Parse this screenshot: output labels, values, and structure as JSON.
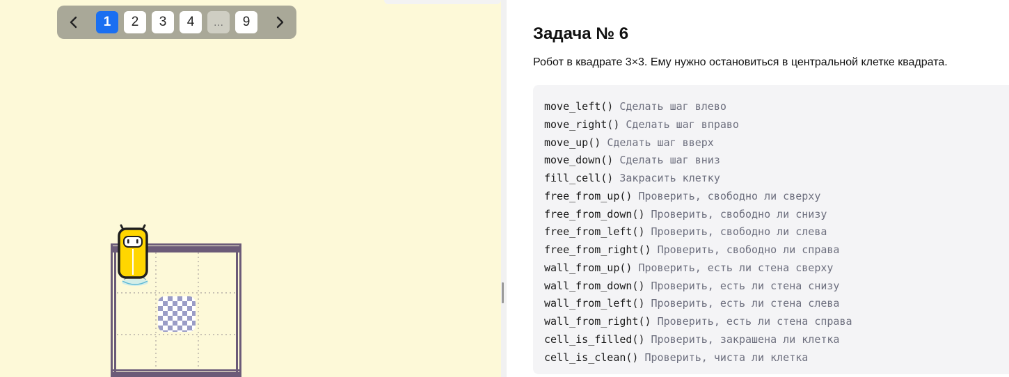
{
  "pager": {
    "pages": [
      "1",
      "2",
      "3",
      "4",
      "…",
      "9"
    ],
    "active_page": "1"
  },
  "task": {
    "title": "Задача № 6",
    "description": "Робот в квадрате 3×3. Ему нужно остановиться в центральной клетке квадрата."
  },
  "commands": [
    {
      "name": "move_left()",
      "hint": "Сделать шаг влево"
    },
    {
      "name": "move_right()",
      "hint": "Сделать шаг вправо"
    },
    {
      "name": "move_up()",
      "hint": "Сделать шаг вверх"
    },
    {
      "name": "move_down()",
      "hint": "Сделать шаг вниз"
    },
    {
      "name": "fill_cell()",
      "hint": "Закрасить клетку"
    },
    {
      "name": "free_from_up()",
      "hint": "Проверить, свободно ли сверху"
    },
    {
      "name": "free_from_down()",
      "hint": "Проверить, свободно ли снизу"
    },
    {
      "name": "free_from_left()",
      "hint": "Проверить, свободно ли слева"
    },
    {
      "name": "free_from_right()",
      "hint": "Проверить, свободно ли справа"
    },
    {
      "name": "wall_from_up()",
      "hint": "Проверить, есть ли стена сверху"
    },
    {
      "name": "wall_from_down()",
      "hint": "Проверить, есть ли стена снизу"
    },
    {
      "name": "wall_from_left()",
      "hint": "Проверить, есть ли стена слева"
    },
    {
      "name": "wall_from_right()",
      "hint": "Проверить, есть ли стена справа"
    },
    {
      "name": "cell_is_filled()",
      "hint": "Проверить, закрашена ли клетка"
    },
    {
      "name": "cell_is_clean()",
      "hint": "Проверить, чиста ли клетка"
    }
  ],
  "colors": {
    "game_background": "#fdf9d8",
    "active_page": "#1a6ff1",
    "wall": "#6b5b78",
    "robot_body": "#ffd600",
    "target_checker": "#9a9cc6"
  },
  "icons": {
    "prev": "chevron-left-icon",
    "next": "chevron-right-icon"
  }
}
